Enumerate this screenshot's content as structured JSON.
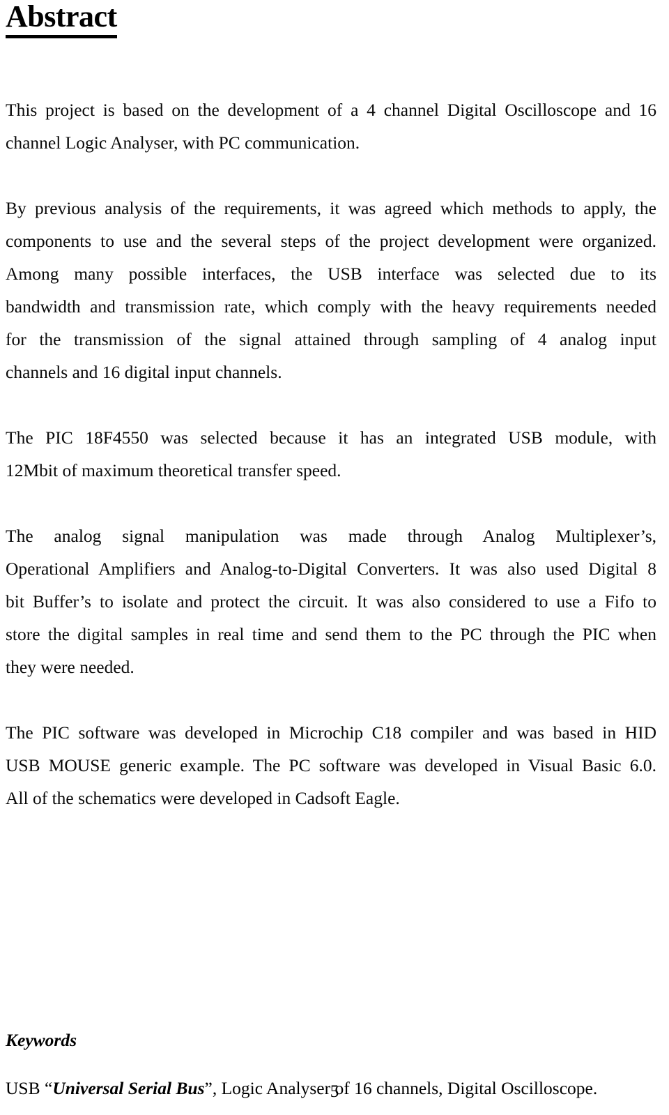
{
  "document": {
    "heading": "Abstract",
    "page_number": "5",
    "paragraphs": [
      {
        "id": "p1",
        "lines": [
          "This project is based on the development of a 4 channel Digital Oscilloscope and 16",
          "channel Logic Analyser, with PC communication."
        ],
        "text": "This project is based on the development of a 4 channel Digital Oscilloscope and 16 channel Logic Analyser, with PC communication."
      },
      {
        "id": "p2",
        "lines": [
          "By previous analysis of the requirements, it was agreed which methods to apply, the",
          "components to use and the several steps of the project development were organized."
        ],
        "text": "By previous analysis of the requirements, it was agreed which methods to apply, the components to use and the several steps of the project development were organized."
      },
      {
        "id": "p3",
        "lines": [
          "Among many possible interfaces, the USB interface was selected due to its",
          "bandwidth and transmission rate, which comply with the heavy requirements needed",
          "for the transmission of the signal attained through sampling of 4 analog input",
          "channels and 16 digital input channels."
        ],
        "text": "Among many possible interfaces, the USB interface was selected due to its bandwidth and transmission rate, which comply with the heavy requirements needed for the transmission of the signal attained through sampling of 4 analog input channels and 16 digital input channels."
      },
      {
        "id": "p4",
        "lines": [
          "The PIC 18F4550 was selected because it has an integrated USB module, with",
          "12Mbit of maximum theoretical transfer speed."
        ],
        "text": "The PIC 18F4550 was selected because it has an integrated USB module, with 12Mbit of maximum theoretical transfer speed."
      },
      {
        "id": "p5",
        "lines": [
          "The analog signal manipulation was made through Analog Multiplexer’s,",
          "Operational Amplifiers and Analog-to-Digital Converters. It was also used Digital 8",
          "bit Buffer’s to isolate and protect the circuit. It was also considered to use a Fifo to",
          "store the digital samples in real time and send them to the PC through the PIC when",
          "they were needed."
        ],
        "text": "The analog signal manipulation was made through Analog Multiplexer’s, Operational Amplifiers and Analog-to-Digital Converters. It was also used Digital 8 bit Buffer’s to isolate and protect the circuit. It was also considered to use a Fifo to store the digital samples in real time and send them to the PC through the PIC when they were needed."
      },
      {
        "id": "p6",
        "lines": [
          "The PIC software was developed in Microchip C18 compiler and was based in HID",
          "USB MOUSE generic example. The PC software was developed in Visual Basic 6.0.",
          "All of the schematics were developed in Cadsoft Eagle."
        ],
        "text": "The PIC software was developed in Microchip C18 compiler and was based in HID USB MOUSE generic example. The PC software was developed in Visual Basic 6.0. All of the schematics were developed in Cadsoft Eagle."
      }
    ],
    "keywords": {
      "heading": "Keywords",
      "prefix": "USB “",
      "emphasis": "Universal Serial Bus",
      "suffix": "”, Logic Analyser of 16 channels, Digital Oscilloscope."
    }
  }
}
